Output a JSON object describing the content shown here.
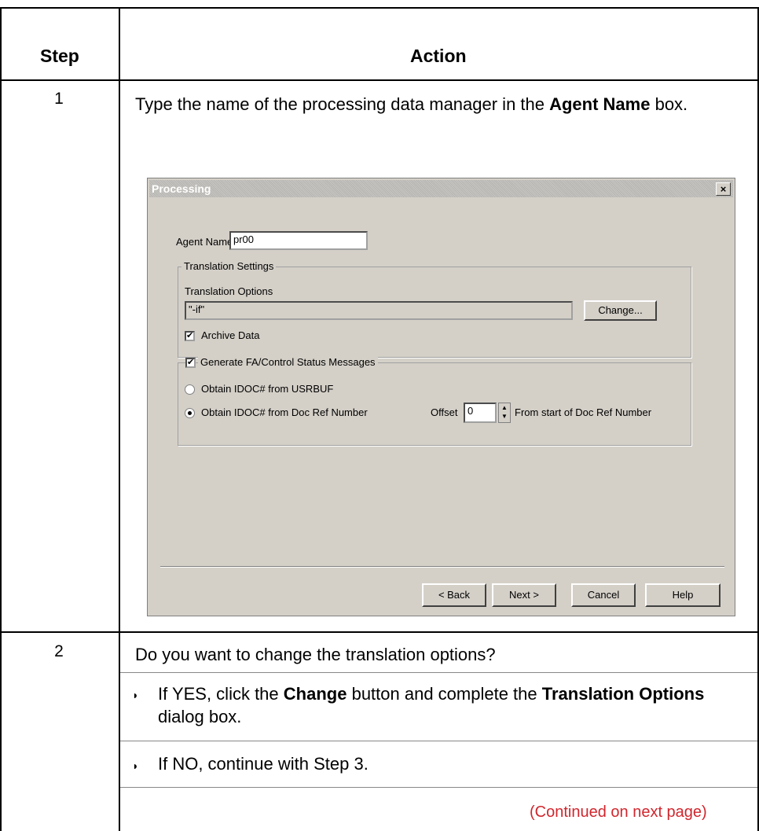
{
  "table": {
    "headers": {
      "step": "Step",
      "action": "Action"
    },
    "rows": [
      {
        "step": "1",
        "text_before": "Type the name of the processing data manager in the ",
        "text_bold": "Agent Name",
        "text_after": " box."
      },
      {
        "step": "2",
        "text": "Do you want to change the translation options?",
        "bullets": [
          {
            "t1": "If YES, click the ",
            "b1": "Change",
            "t2": " button and complete the ",
            "b2": "Translation Options",
            "t3": " dialog box."
          },
          {
            "t1": "If NO, continue with Step 3."
          }
        ],
        "bullet_glyph": "◗"
      }
    ],
    "continued": "(Continued on next page)",
    "continued_color": "#d0262d"
  },
  "dialog": {
    "title": "Processing",
    "close_glyph": "×",
    "agent_name_label": "Agent Name",
    "agent_name_value": "pr00",
    "translation_settings_title": "Translation Settings",
    "translation_options_label": "Translation Options",
    "translation_options_value": "\"-if\"",
    "change_button": "Change...",
    "archive_data_label": "Archive Data",
    "archive_data_checked": true,
    "generate_fa_label": "Generate FA/Control Status Messages",
    "generate_fa_checked": true,
    "radio_usrbuf_label": "Obtain IDOC# from USRBUF",
    "radio_docref_label": "Obtain IDOC# from Doc Ref Number",
    "radio_selected": "docref",
    "offset_label": "Offset",
    "offset_value": "0",
    "offset_suffix": "From start of Doc Ref Number",
    "buttons": {
      "back": "< Back",
      "next": "Next >",
      "cancel": "Cancel",
      "help": "Help"
    },
    "check_glyph": "✔"
  }
}
